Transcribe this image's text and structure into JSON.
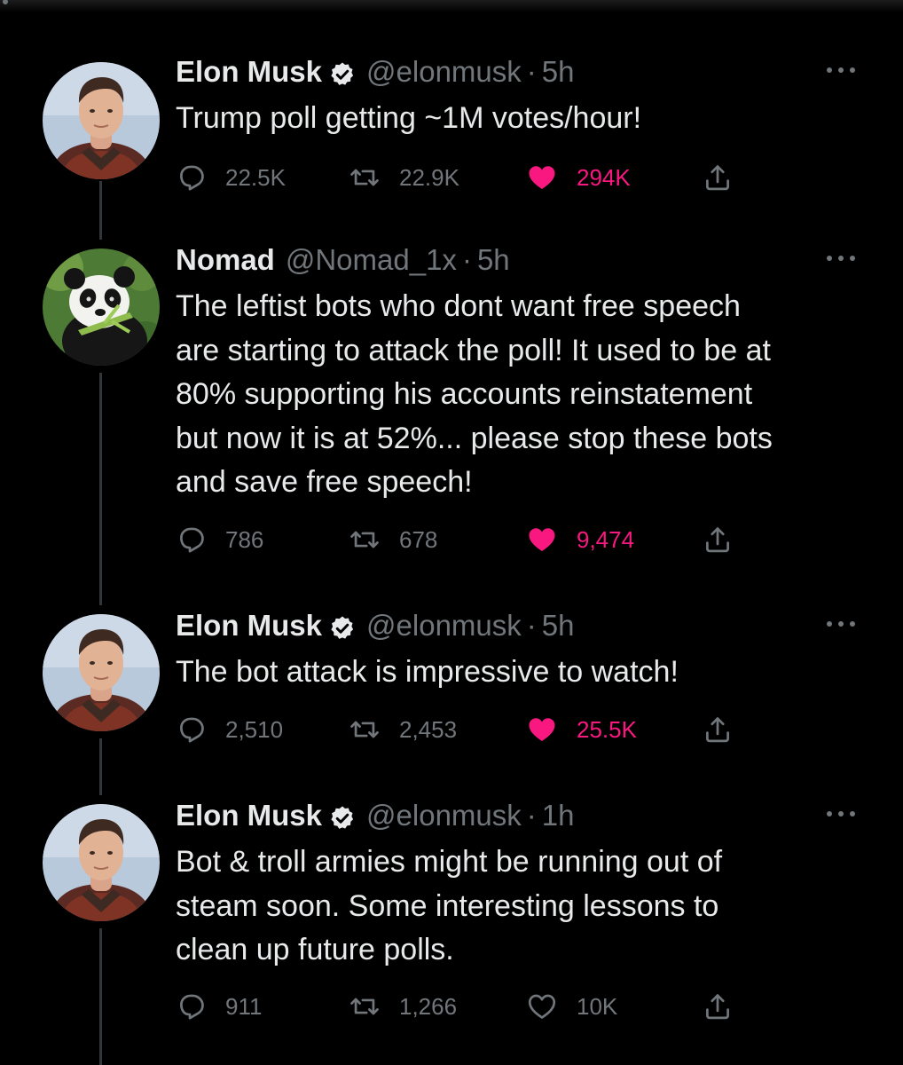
{
  "colors": {
    "background": "#000000",
    "primary_text": "#e7e9ea",
    "secondary_text": "#71767b",
    "like_active": "#f91880",
    "thread_line": "#333639"
  },
  "icons": {
    "reply": "reply-icon",
    "retweet": "retweet-icon",
    "like": "heart-icon",
    "share": "share-icon",
    "more": "more-icon",
    "verified": "verified-badge-icon"
  },
  "tweets": [
    {
      "name": "Elon Musk",
      "verified": true,
      "handle": "@elonmusk",
      "separator": "·",
      "time": "5h",
      "text": "Trump poll getting ~1M votes/hour!",
      "replies": "22.5K",
      "retweets": "22.9K",
      "likes": "294K",
      "liked": true
    },
    {
      "name": "Nomad",
      "verified": false,
      "handle": "@Nomad_1x",
      "separator": "·",
      "time": "5h",
      "text": "The leftist bots who dont want free speech\nare starting to attack the poll! It used to be at\n80% supporting his accounts reinstatement\nbut now it is at 52%... please stop these bots\nand save free speech!",
      "replies": "786",
      "retweets": "678",
      "likes": "9,474",
      "liked": true
    },
    {
      "name": "Elon Musk",
      "verified": true,
      "handle": "@elonmusk",
      "separator": "·",
      "time": "5h",
      "text": "The bot attack is impressive to watch!",
      "replies": "2,510",
      "retweets": "2,453",
      "likes": "25.5K",
      "liked": true
    },
    {
      "name": "Elon Musk",
      "verified": true,
      "handle": "@elonmusk",
      "separator": "·",
      "time": "1h",
      "text": "Bot & troll armies might be running out of\nsteam soon. Some interesting lessons to\nclean up future polls.",
      "replies": "911",
      "retweets": "1,266",
      "likes": "10K",
      "liked": false
    }
  ]
}
